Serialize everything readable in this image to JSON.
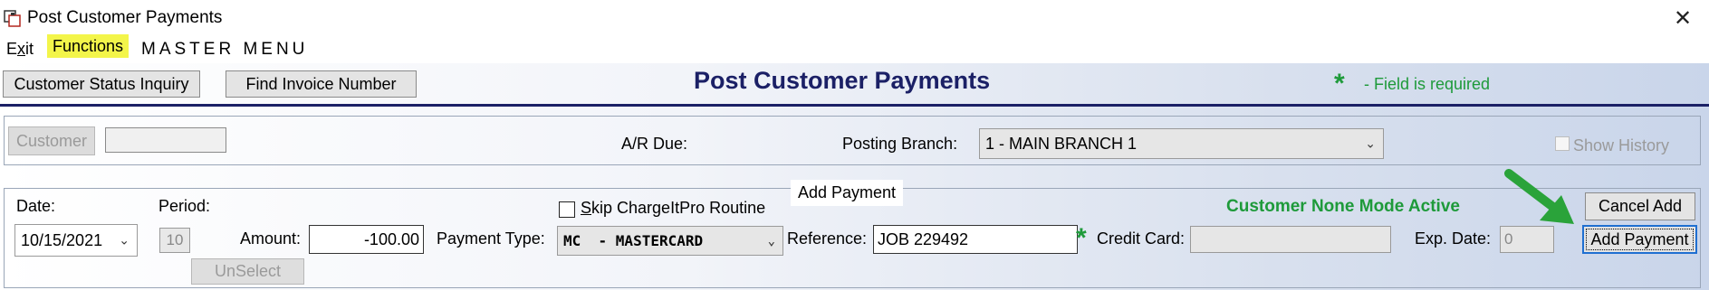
{
  "window": {
    "title": "Post Customer Payments"
  },
  "menu": {
    "exit": "Exit",
    "functions": "Functions",
    "master": "MASTER MENU"
  },
  "toolbar": {
    "status_inquiry": "Customer Status Inquiry",
    "find_invoice": "Find Invoice Number",
    "page_title": "Post Customer Payments",
    "required_star": "*",
    "required_text": "- Field is required"
  },
  "customer_section": {
    "customer_button": "Customer",
    "customer_value": "",
    "ar_due_label": "A/R Due:",
    "posting_branch_label": "Posting Branch:",
    "posting_branch_value": "1  - MAIN BRANCH 1",
    "show_history_label": "Show History",
    "show_history_checked": false
  },
  "payment_section": {
    "legend": "Add Payment",
    "date_label": "Date:",
    "date_value": "10/15/2021",
    "period_label": "Period:",
    "period_value": "10",
    "skip_label": "Skip ChargeItPro Routine",
    "skip_checked": false,
    "mode_text": "Customer None Mode Active",
    "cancel_add": "Cancel Add",
    "amount_label": "Amount:",
    "amount_value": "-100.00",
    "payment_type_label": "Payment Type:",
    "payment_type_value": "MC  - MASTERCARD",
    "reference_label": "Reference:",
    "reference_value": "JOB 229492",
    "reference_required": "*",
    "credit_card_label": "Credit Card:",
    "credit_card_value": "",
    "exp_date_label": "Exp. Date:",
    "exp_date_value": "0",
    "add_payment": "Add Payment",
    "unselect": "UnSelect"
  },
  "colors": {
    "title_navy": "#1b2066",
    "required_green": "#1e9a3a",
    "highlight_yellow": "#f3f54a",
    "arrow_green": "#2aa33a"
  },
  "icons": [
    "app-icon",
    "close-icon",
    "chevron-down-icon",
    "green-arrow-icon"
  ]
}
